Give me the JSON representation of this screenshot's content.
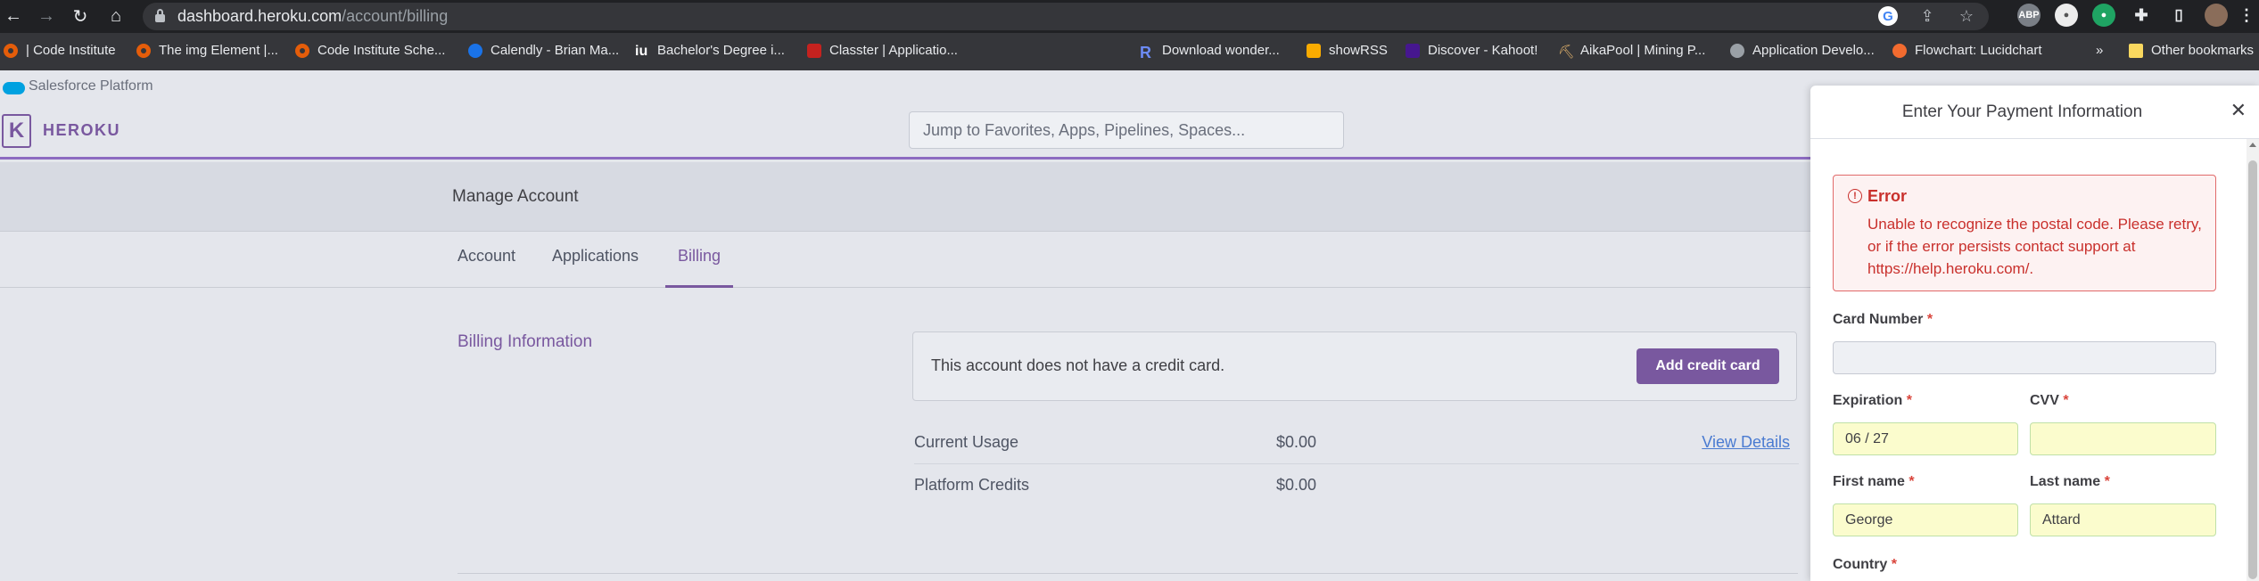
{
  "browser": {
    "url_host": "dashboard.heroku.com",
    "url_path": "/account/billing",
    "bookmarks": [
      {
        "label": "| Code Institute",
        "icon": "code-institute-icon"
      },
      {
        "label": "The img Element |...",
        "icon": "code-institute-icon"
      },
      {
        "label": "Code Institute Sche...",
        "icon": "code-institute-icon"
      },
      {
        "label": "Calendly - Brian Ma...",
        "icon": "calendly-icon"
      },
      {
        "label": "Bachelor's Degree i...",
        "icon": "iu-icon"
      },
      {
        "label": "Classter | Applicatio...",
        "icon": "classter-icon"
      },
      {
        "label": "Download wonder...",
        "icon": "r-icon"
      },
      {
        "label": "showRSS",
        "icon": "rss-icon"
      },
      {
        "label": "Discover - Kahoot!",
        "icon": "kahoot-icon"
      },
      {
        "label": "AikaPool | Mining P...",
        "icon": "pickaxe-icon"
      },
      {
        "label": "Application Develo...",
        "icon": "globe-icon"
      },
      {
        "label": "Flowchart: Lucidchart",
        "icon": "lucidchart-icon"
      }
    ],
    "bookmarks_overflow": "»",
    "other_bookmarks": "Other bookmarks"
  },
  "salesforce": {
    "label": "Salesforce Platform"
  },
  "heroku": {
    "brand": "HEROKU",
    "logo_letter": "K",
    "search_placeholder": "Jump to Favorites, Apps, Pipelines, Spaces...",
    "section_title": "Manage Account",
    "tabs": [
      "Account",
      "Applications",
      "Billing"
    ],
    "active_tab": "Billing"
  },
  "billing": {
    "heading": "Billing Information",
    "no_card_message": "This account does not have a credit card.",
    "add_card_label": "Add credit card",
    "current_usage_label": "Current Usage",
    "current_usage_value": "$0.00",
    "view_details_label": "View Details",
    "platform_credits_label": "Platform Credits",
    "platform_credits_value": "$0.00"
  },
  "payment_modal": {
    "title": "Enter Your Payment Information",
    "close_glyph": "✕",
    "error_title": "Error",
    "error_message": "Unable to recognize the postal code. Please retry, or if the error persists contact support at https://help.heroku.com/.",
    "card_number_label": "Card Number",
    "card_number_value": "",
    "expiration_label": "Expiration",
    "expiration_value": "06 / 27",
    "cvv_label": "CVV",
    "cvv_value": "",
    "first_name_label": "First name",
    "first_name_value": "George",
    "last_name_label": "Last name",
    "last_name_value": "Attard",
    "country_label": "Country",
    "required_marker": "*"
  }
}
